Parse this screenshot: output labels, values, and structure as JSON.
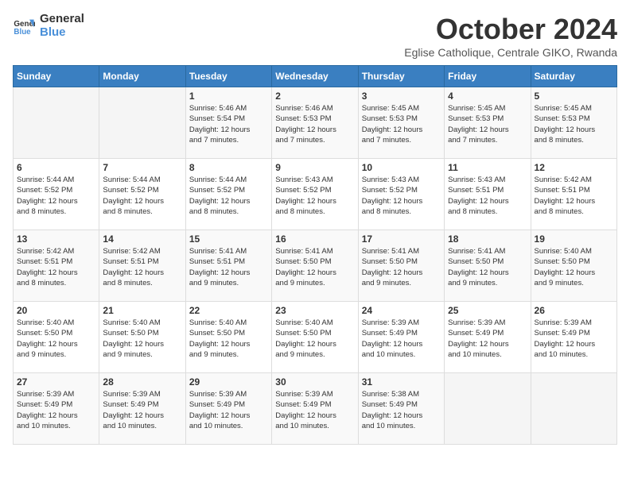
{
  "logo": {
    "line1": "General",
    "line2": "Blue"
  },
  "title": "October 2024",
  "subtitle": "Eglise Catholique, Centrale GIKO, Rwanda",
  "days_of_week": [
    "Sunday",
    "Monday",
    "Tuesday",
    "Wednesday",
    "Thursday",
    "Friday",
    "Saturday"
  ],
  "weeks": [
    [
      {
        "day": "",
        "info": ""
      },
      {
        "day": "",
        "info": ""
      },
      {
        "day": "1",
        "info": "Sunrise: 5:46 AM\nSunset: 5:54 PM\nDaylight: 12 hours\nand 7 minutes."
      },
      {
        "day": "2",
        "info": "Sunrise: 5:46 AM\nSunset: 5:53 PM\nDaylight: 12 hours\nand 7 minutes."
      },
      {
        "day": "3",
        "info": "Sunrise: 5:45 AM\nSunset: 5:53 PM\nDaylight: 12 hours\nand 7 minutes."
      },
      {
        "day": "4",
        "info": "Sunrise: 5:45 AM\nSunset: 5:53 PM\nDaylight: 12 hours\nand 7 minutes."
      },
      {
        "day": "5",
        "info": "Sunrise: 5:45 AM\nSunset: 5:53 PM\nDaylight: 12 hours\nand 8 minutes."
      }
    ],
    [
      {
        "day": "6",
        "info": "Sunrise: 5:44 AM\nSunset: 5:52 PM\nDaylight: 12 hours\nand 8 minutes."
      },
      {
        "day": "7",
        "info": "Sunrise: 5:44 AM\nSunset: 5:52 PM\nDaylight: 12 hours\nand 8 minutes."
      },
      {
        "day": "8",
        "info": "Sunrise: 5:44 AM\nSunset: 5:52 PM\nDaylight: 12 hours\nand 8 minutes."
      },
      {
        "day": "9",
        "info": "Sunrise: 5:43 AM\nSunset: 5:52 PM\nDaylight: 12 hours\nand 8 minutes."
      },
      {
        "day": "10",
        "info": "Sunrise: 5:43 AM\nSunset: 5:52 PM\nDaylight: 12 hours\nand 8 minutes."
      },
      {
        "day": "11",
        "info": "Sunrise: 5:43 AM\nSunset: 5:51 PM\nDaylight: 12 hours\nand 8 minutes."
      },
      {
        "day": "12",
        "info": "Sunrise: 5:42 AM\nSunset: 5:51 PM\nDaylight: 12 hours\nand 8 minutes."
      }
    ],
    [
      {
        "day": "13",
        "info": "Sunrise: 5:42 AM\nSunset: 5:51 PM\nDaylight: 12 hours\nand 8 minutes."
      },
      {
        "day": "14",
        "info": "Sunrise: 5:42 AM\nSunset: 5:51 PM\nDaylight: 12 hours\nand 8 minutes."
      },
      {
        "day": "15",
        "info": "Sunrise: 5:41 AM\nSunset: 5:51 PM\nDaylight: 12 hours\nand 9 minutes."
      },
      {
        "day": "16",
        "info": "Sunrise: 5:41 AM\nSunset: 5:50 PM\nDaylight: 12 hours\nand 9 minutes."
      },
      {
        "day": "17",
        "info": "Sunrise: 5:41 AM\nSunset: 5:50 PM\nDaylight: 12 hours\nand 9 minutes."
      },
      {
        "day": "18",
        "info": "Sunrise: 5:41 AM\nSunset: 5:50 PM\nDaylight: 12 hours\nand 9 minutes."
      },
      {
        "day": "19",
        "info": "Sunrise: 5:40 AM\nSunset: 5:50 PM\nDaylight: 12 hours\nand 9 minutes."
      }
    ],
    [
      {
        "day": "20",
        "info": "Sunrise: 5:40 AM\nSunset: 5:50 PM\nDaylight: 12 hours\nand 9 minutes."
      },
      {
        "day": "21",
        "info": "Sunrise: 5:40 AM\nSunset: 5:50 PM\nDaylight: 12 hours\nand 9 minutes."
      },
      {
        "day": "22",
        "info": "Sunrise: 5:40 AM\nSunset: 5:50 PM\nDaylight: 12 hours\nand 9 minutes."
      },
      {
        "day": "23",
        "info": "Sunrise: 5:40 AM\nSunset: 5:50 PM\nDaylight: 12 hours\nand 9 minutes."
      },
      {
        "day": "24",
        "info": "Sunrise: 5:39 AM\nSunset: 5:49 PM\nDaylight: 12 hours\nand 10 minutes."
      },
      {
        "day": "25",
        "info": "Sunrise: 5:39 AM\nSunset: 5:49 PM\nDaylight: 12 hours\nand 10 minutes."
      },
      {
        "day": "26",
        "info": "Sunrise: 5:39 AM\nSunset: 5:49 PM\nDaylight: 12 hours\nand 10 minutes."
      }
    ],
    [
      {
        "day": "27",
        "info": "Sunrise: 5:39 AM\nSunset: 5:49 PM\nDaylight: 12 hours\nand 10 minutes."
      },
      {
        "day": "28",
        "info": "Sunrise: 5:39 AM\nSunset: 5:49 PM\nDaylight: 12 hours\nand 10 minutes."
      },
      {
        "day": "29",
        "info": "Sunrise: 5:39 AM\nSunset: 5:49 PM\nDaylight: 12 hours\nand 10 minutes."
      },
      {
        "day": "30",
        "info": "Sunrise: 5:39 AM\nSunset: 5:49 PM\nDaylight: 12 hours\nand 10 minutes."
      },
      {
        "day": "31",
        "info": "Sunrise: 5:38 AM\nSunset: 5:49 PM\nDaylight: 12 hours\nand 10 minutes."
      },
      {
        "day": "",
        "info": ""
      },
      {
        "day": "",
        "info": ""
      }
    ]
  ]
}
